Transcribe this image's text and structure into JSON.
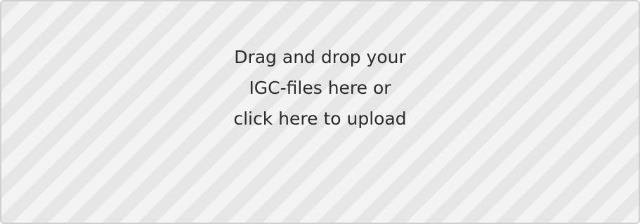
{
  "dropzone": {
    "lines": [
      "Drag and drop your",
      "IGC-files here or",
      "click here to upload"
    ]
  },
  "colors": {
    "background": "#f3f3f3",
    "stripe": "#e6e6e6",
    "border": "#cfcfcf",
    "text": "#2b2b2b"
  }
}
